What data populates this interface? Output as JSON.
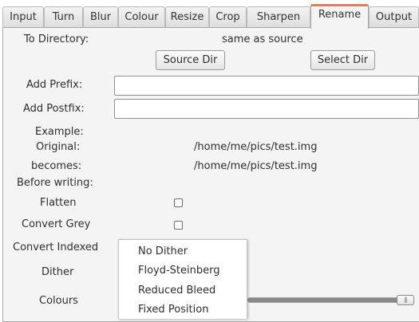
{
  "tabs": [
    {
      "label": "Input",
      "active": false
    },
    {
      "label": "Turn",
      "active": false
    },
    {
      "label": "Blur",
      "active": false
    },
    {
      "label": "Colour",
      "active": false
    },
    {
      "label": "Resize",
      "active": false
    },
    {
      "label": "Crop",
      "active": false
    },
    {
      "label": "Sharpen",
      "active": false
    },
    {
      "label": "Rename",
      "active": true
    },
    {
      "label": "Output",
      "active": false
    }
  ],
  "rename": {
    "to_directory_label": "To Directory:",
    "to_directory_value": "same as source",
    "source_dir_button": "Source Dir",
    "select_dir_button": "Select Dir",
    "add_prefix_label": "Add Prefix:",
    "add_prefix_value": "",
    "add_postfix_label": "Add Postfix:",
    "add_postfix_value": "",
    "example_label": "Example:",
    "original_label": "Original:",
    "original_value": "/home/me/pics/test.img",
    "becomes_label": "becomes:",
    "becomes_value": "/home/me/pics/test.img"
  },
  "before_writing": {
    "heading": "Before writing:",
    "flatten_label": "Flatten",
    "flatten_checked": false,
    "convert_grey_label": "Convert Grey",
    "convert_grey_checked": false,
    "convert_indexed_label": "Convert Indexed",
    "dither_label": "Dither",
    "colours_label": "Colours",
    "colours_slider_level": 1.0
  },
  "dither_dropdown": {
    "options": [
      "No Dither",
      "Floyd-Steinberg",
      "Reduced Bleed",
      "Fixed Position"
    ]
  },
  "colors": {
    "accent": "#f07746",
    "panel_bg": "#f4f4f4"
  }
}
